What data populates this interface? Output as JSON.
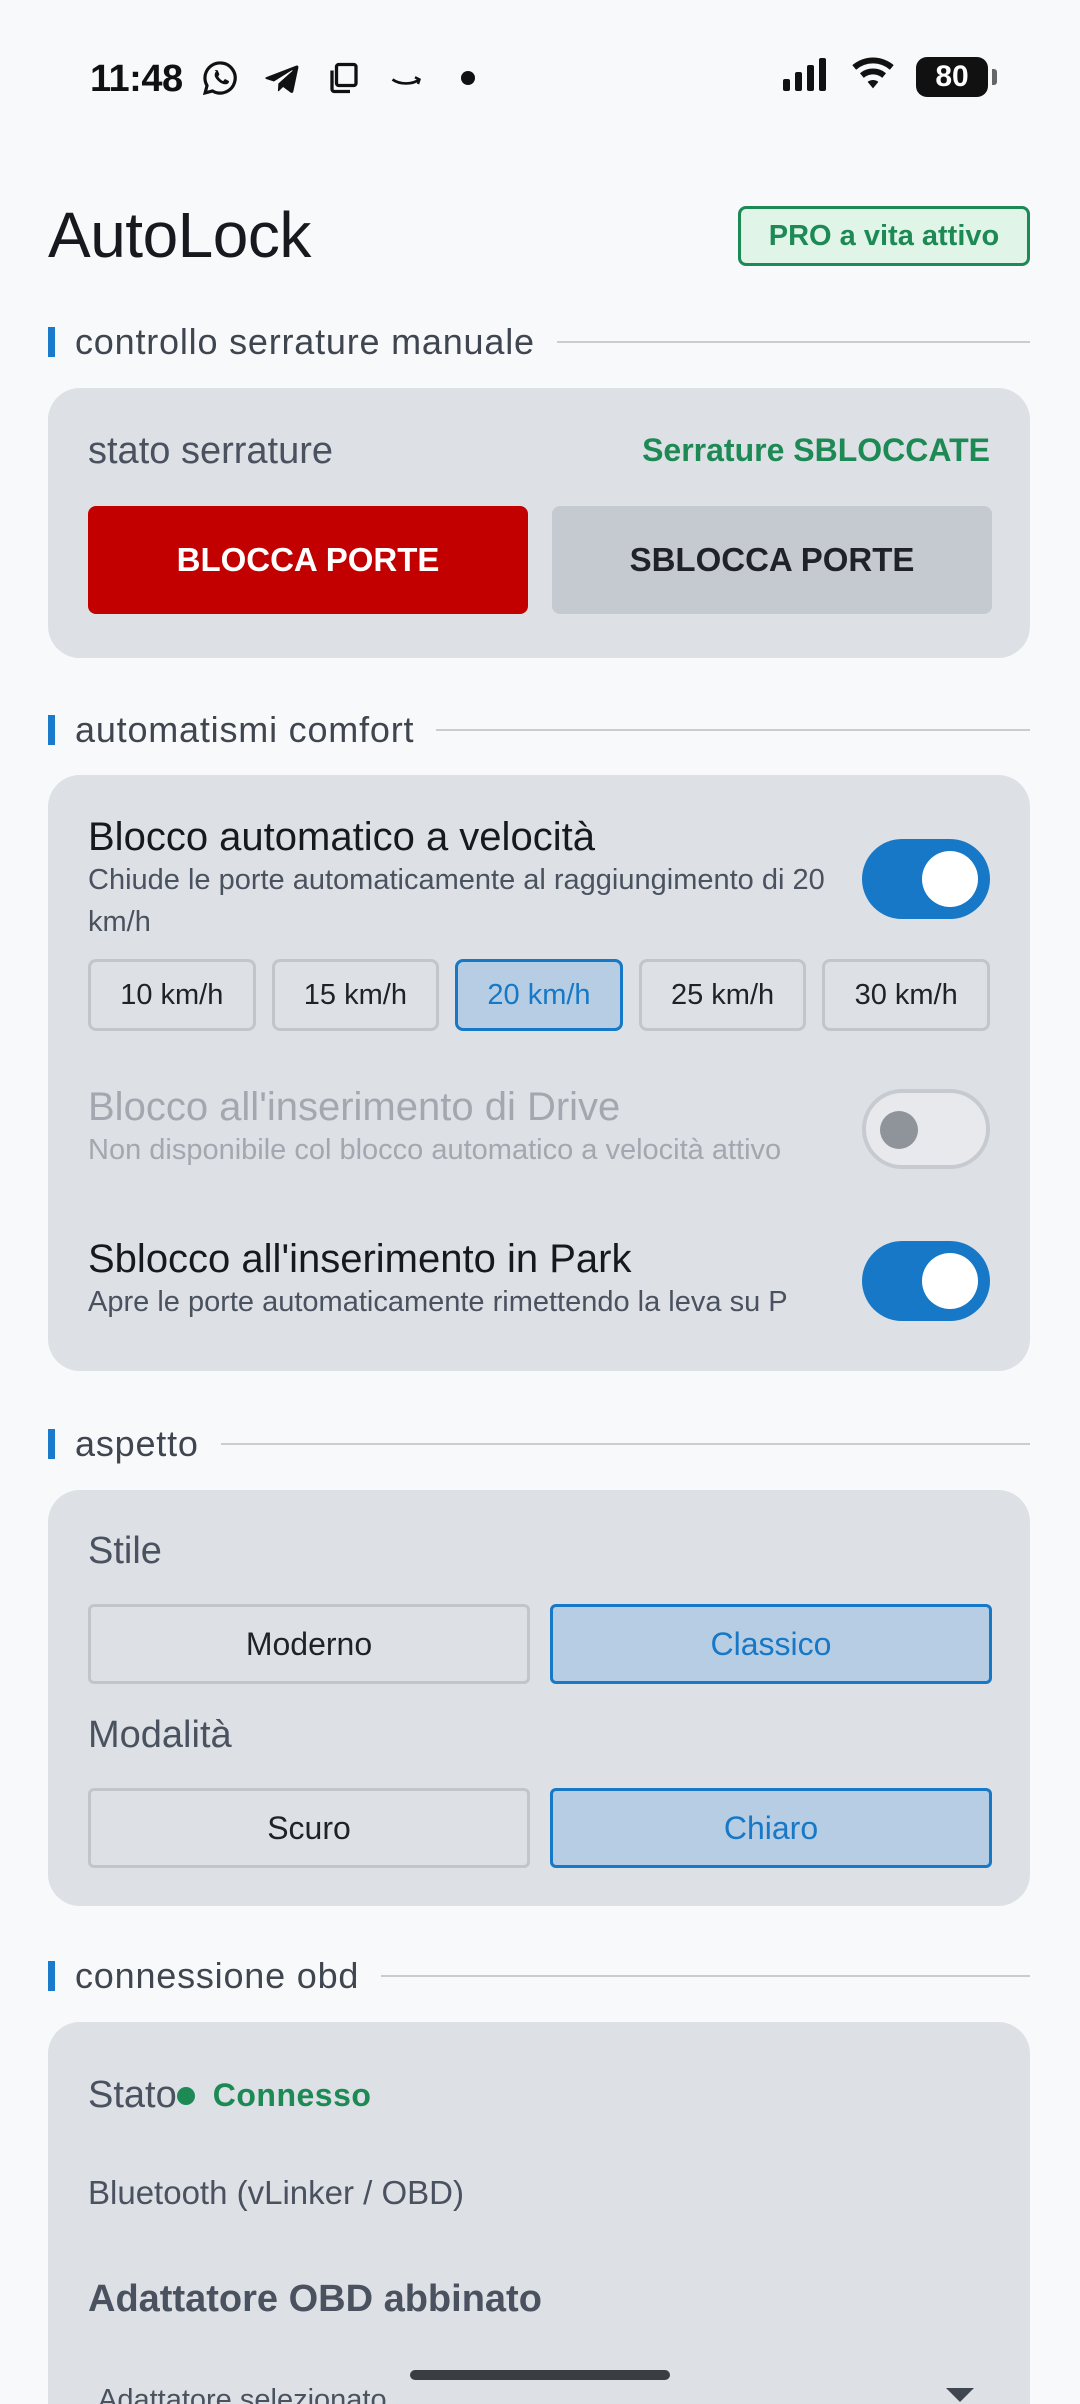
{
  "status_bar": {
    "time": "11:48",
    "left_icons": [
      "whatsapp-icon",
      "telegram-icon",
      "copy-icon",
      "amazon-icon",
      "dot-icon"
    ],
    "battery": "80"
  },
  "header": {
    "title": "AutoLock",
    "pro_badge": "PRO a vita attivo"
  },
  "manual_lock": {
    "section_label": "controllo serrature manuale",
    "state_label": "stato serrature",
    "state_value": "Serrature SBLOCCATE",
    "lock_button": "BLOCCA PORTE",
    "unlock_button": "SBLOCCA PORTE",
    "colors": {
      "lock": "#c20000",
      "ok": "#1d8a55"
    }
  },
  "comfort": {
    "section_label": "automatismi comfort",
    "speed_lock": {
      "title": "Blocco automatico a velocità",
      "description": "Chiude le porte automaticamente al raggiungimento di 20 km/h",
      "enabled": true
    },
    "speed_options": [
      "10 km/h",
      "15 km/h",
      "20 km/h",
      "25 km/h",
      "30 km/h"
    ],
    "selected_speed": "20 km/h",
    "drive_lock": {
      "title": "Blocco all'inserimento di Drive",
      "description": "Non disponibile col blocco automatico a velocità attivo",
      "enabled": false,
      "disabled": true
    },
    "park_unlock": {
      "title": "Sblocco all'inserimento in Park",
      "description": "Apre le porte automaticamente rimettendo la leva su P",
      "enabled": true
    }
  },
  "appearance": {
    "section_label": "aspetto",
    "style_label": "Stile",
    "style_options": [
      "Moderno",
      "Classico"
    ],
    "selected_style": "Classico",
    "mode_label": "Modalità",
    "mode_options": [
      "Scuro",
      "Chiaro"
    ],
    "selected_mode": "Chiaro"
  },
  "obd": {
    "section_label": "connessione obd",
    "state_label": "Stato",
    "state_value": "Connesso",
    "connection_type": "Bluetooth (vLinker / OBD)",
    "paired_title": "Adattatore OBD abbinato",
    "select_label": "Adattatore selezionato"
  },
  "theme": {
    "accent": "#1678c6",
    "card_bg": "#dde0e5",
    "page_bg": "#f8f9fa"
  }
}
